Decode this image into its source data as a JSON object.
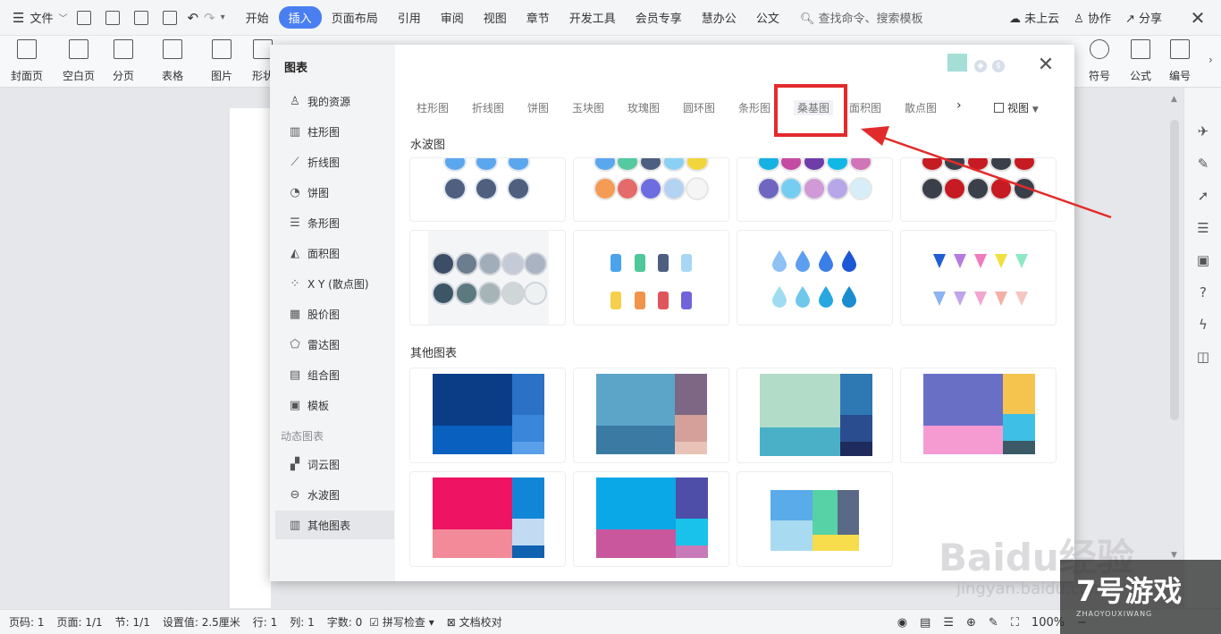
{
  "menubar": {
    "file_label": "文件",
    "tabs": [
      "开始",
      "插入",
      "页面布局",
      "引用",
      "审阅",
      "视图",
      "章节",
      "开发工具",
      "会员专享",
      "慧办公",
      "公文"
    ],
    "active_tab_index": 1,
    "search_placeholder": "查找命令、搜索模板",
    "right_items": [
      "未上云",
      "协作",
      "分享"
    ]
  },
  "ribbon": {
    "left_items": [
      "封面页",
      "空白页",
      "分页",
      "表格",
      "图片",
      "形状"
    ],
    "right_items": [
      "符号",
      "公式",
      "编号"
    ]
  },
  "dialog": {
    "title": "图表",
    "sidebar": [
      {
        "label": "我的资源",
        "icon": "user-icon"
      },
      {
        "label": "柱形图",
        "icon": "column-chart-icon"
      },
      {
        "label": "折线图",
        "icon": "line-chart-icon"
      },
      {
        "label": "饼图",
        "icon": "pie-chart-icon"
      },
      {
        "label": "条形图",
        "icon": "bar-chart-icon"
      },
      {
        "label": "面积图",
        "icon": "area-chart-icon"
      },
      {
        "label": "X Y (散点图)",
        "icon": "scatter-chart-icon"
      },
      {
        "label": "股价图",
        "icon": "stock-chart-icon"
      },
      {
        "label": "雷达图",
        "icon": "radar-chart-icon"
      },
      {
        "label": "组合图",
        "icon": "combo-chart-icon"
      },
      {
        "label": "模板",
        "icon": "template-icon"
      }
    ],
    "dynamic_group_label": "动态图表",
    "dynamic_items": [
      {
        "label": "词云图",
        "icon": "wordcloud-icon"
      },
      {
        "label": "水波图",
        "icon": "waterwave-icon"
      },
      {
        "label": "其他图表",
        "icon": "other-chart-icon",
        "active": true
      }
    ],
    "tabs": [
      "柱形图",
      "折线图",
      "饼图",
      "玉块图",
      "玫瑰图",
      "圆环图",
      "条形图",
      "桑基图",
      "面积图",
      "散点图"
    ],
    "highlighted_tab": "桑基图",
    "view_label": "视图",
    "section_water": "水波图",
    "section_other": "其他图表"
  },
  "statusbar": {
    "page": "页码: 1",
    "pages": "页面: 1/1",
    "section": "节: 1/1",
    "setting": "设置值: 2.5厘米",
    "row": "行: 1",
    "col": "列: 1",
    "words": "字数: 0",
    "spell": "拼写检查",
    "proof": "文档校对",
    "zoom": "100%"
  },
  "watermark": {
    "baidu": "Baidu经验",
    "url": "jingyan.baidu.com",
    "game": "7号游戏",
    "game_sub": "ZHAOYOUXIWANG"
  }
}
